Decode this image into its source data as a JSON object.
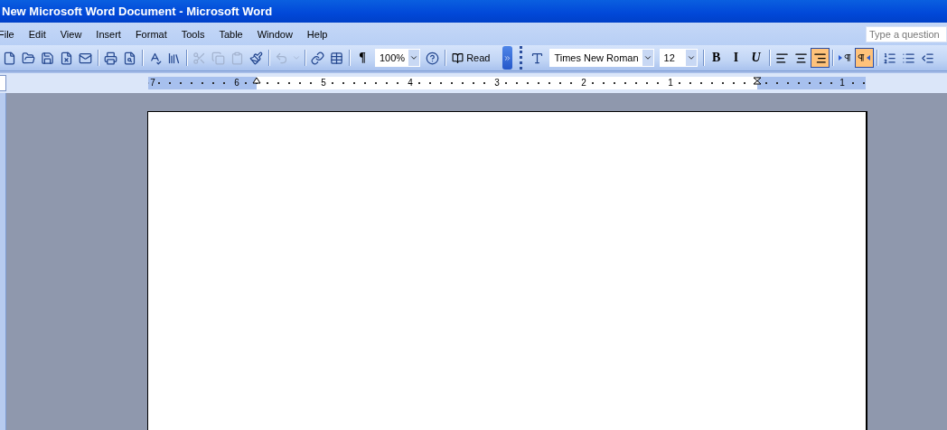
{
  "window": {
    "title": "New Microsoft Word Document - Microsoft Word"
  },
  "menu": [
    "File",
    "Edit",
    "View",
    "Insert",
    "Format",
    "Tools",
    "Table",
    "Window",
    "Help"
  ],
  "question_box": {
    "placeholder": "Type a question"
  },
  "standard_toolbar": [
    {
      "kind": "icon",
      "disabled": false
    },
    {
      "kind": "icon",
      "disabled": false
    },
    {
      "kind": "icon",
      "disabled": false
    },
    {
      "kind": "icon",
      "disabled": false
    },
    {
      "kind": "icon",
      "disabled": false
    },
    {
      "kind": "separator"
    },
    {
      "kind": "icon",
      "disabled": false
    },
    {
      "kind": "icon",
      "disabled": false
    },
    {
      "kind": "separator"
    },
    {
      "kind": "icon",
      "disabled": false
    },
    {
      "kind": "icon",
      "disabled": false
    },
    {
      "kind": "separator"
    },
    {
      "kind": "icon",
      "disabled": true
    },
    {
      "kind": "icon",
      "disabled": true
    },
    {
      "kind": "icon",
      "disabled": true
    },
    {
      "kind": "icon",
      "disabled": false
    },
    {
      "kind": "separator"
    },
    {
      "kind": "icon",
      "disabled": true
    },
    {
      "kind": "dropdown",
      "disabled": true
    },
    {
      "kind": "separator"
    },
    {
      "kind": "icon",
      "disabled": false
    },
    {
      "kind": "icon",
      "disabled": false
    },
    {
      "kind": "separator"
    },
    {
      "kind": "glyph",
      "label": "¶",
      "selected": false
    },
    {
      "kind": "combo",
      "value": "100%"
    },
    {
      "kind": "icon",
      "disabled": false
    },
    {
      "kind": "separator"
    },
    {
      "kind": "labeled",
      "label": "Read"
    }
  ],
  "formatting_toolbar": [
    {
      "kind": "icon",
      "disabled": false
    },
    {
      "kind": "combo",
      "value": "Times New Roman"
    },
    {
      "kind": "combo",
      "value": "12"
    },
    {
      "kind": "separator"
    },
    {
      "kind": "glyph",
      "label": "B",
      "selected": false
    },
    {
      "kind": "glyph",
      "label": "I",
      "selected": false
    },
    {
      "kind": "glyph",
      "label": "U",
      "selected": false
    },
    {
      "kind": "separator"
    },
    {
      "kind": "align",
      "selected": false
    },
    {
      "kind": "align",
      "selected": false
    },
    {
      "kind": "align",
      "selected": true
    },
    {
      "kind": "separator"
    },
    {
      "kind": "direction",
      "selected": false
    },
    {
      "kind": "direction",
      "selected": true
    },
    {
      "kind": "separator"
    },
    {
      "kind": "icon",
      "disabled": false
    },
    {
      "kind": "icon",
      "disabled": false
    },
    {
      "kind": "icon",
      "disabled": false
    }
  ],
  "ruler": {
    "labels": [
      "7",
      "6",
      "5",
      "4",
      "3",
      "2",
      "1",
      "1"
    ]
  }
}
